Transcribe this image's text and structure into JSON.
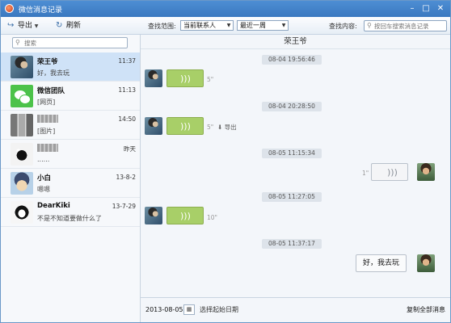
{
  "window": {
    "title": "微信消息记录"
  },
  "toolbar": {
    "export_label": "导出",
    "refresh_label": "刷新",
    "range_label": "查找范围:",
    "contact_select": "当前联系人",
    "period_select": "最近一周",
    "content_label": "查找内容:",
    "content_placeholder": "按回车搜索消息记录"
  },
  "sidebar": {
    "search_placeholder": "搜索",
    "contacts": [
      {
        "name": "荣王爷",
        "preview": "好，我去玩",
        "time": "11:37",
        "avatar": "photo-avatar"
      },
      {
        "name": "微信团队",
        "preview": "[网页]",
        "time": "11:13",
        "avatar": "wechat-logo-avatar"
      },
      {
        "name": "",
        "preview": "[图片]",
        "time": "14:50",
        "avatar": "group-avatar"
      },
      {
        "name": "",
        "preview": "......",
        "time": "昨天",
        "avatar": "cartoon-avatar"
      },
      {
        "name": "小白",
        "preview": "嗯嗯",
        "time": "13-8-2",
        "avatar": "cartoon-avatar"
      },
      {
        "name": "DearKiki",
        "preview": "不是不知道要做什么了",
        "time": "13-7-29",
        "avatar": "cartoon-avatar"
      }
    ]
  },
  "chat": {
    "header": "荣王爷",
    "messages": [
      {
        "stamp": "08-04 19:56:46",
        "duration": "5\""
      },
      {
        "stamp": "08-04 20:28:50",
        "duration": "5\"",
        "action": "导出"
      },
      {
        "stamp": "08-05 11:15:34",
        "duration": "1\""
      },
      {
        "stamp": "08-05 11:27:05",
        "duration": "10\""
      },
      {
        "stamp": "08-05 11:37:17",
        "text": "好，我去玩"
      }
    ]
  },
  "bottom": {
    "date": "2013-08-05",
    "pick_start": "选择起始日期",
    "copy_all": "复制全部消息"
  }
}
